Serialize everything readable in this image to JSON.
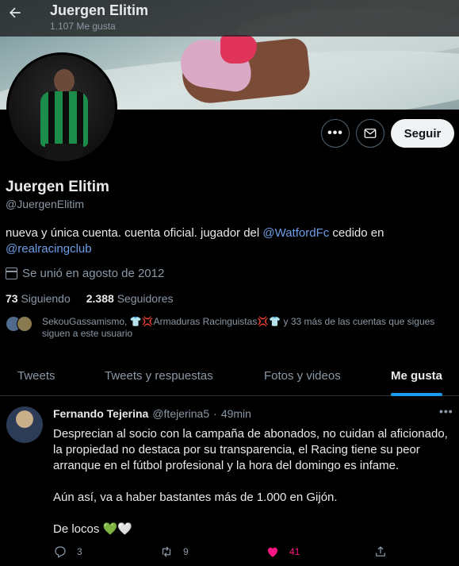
{
  "header": {
    "title": "Juergen Elitim",
    "subtitle": "1.107 Me gusta"
  },
  "profile": {
    "name": "Juergen Elitim",
    "handle": "@JuergenElitim",
    "bio_prefix": "nueva y única cuenta. cuenta oficial. jugador del ",
    "bio_link1": "@WatfordFc",
    "bio_mid": " cedido en ",
    "bio_link2": "@realracingclub",
    "joined": "Se unió en agosto de 2012",
    "following_count": "73",
    "following_label": "Siguiendo",
    "followers_count": "2.388",
    "followers_label": "Seguidores",
    "followed_by": "SekouGassamismo, 👕💢Armaduras Racinguistas💢👕 y 33 más de las cuentas que sigues siguen a este usuario",
    "follow_label": "Seguir",
    "more_label": "•••"
  },
  "tabs": [
    {
      "label": "Tweets"
    },
    {
      "label": "Tweets y respuestas"
    },
    {
      "label": "Fotos y videos"
    },
    {
      "label": "Me gusta"
    }
  ],
  "tweet": {
    "name": "Fernando Tejerina",
    "handle": "@ftejerina5",
    "dot": "·",
    "time": "49min",
    "more": "•••",
    "paragraph1": "Desprecian al socio con la campaña de abonados, no cuidan al aficionado, la propiedad no destaca por su transparencia, el Racing tiene su peor arranque en el fútbol profesional y la hora del domingo es infame.",
    "paragraph2": "Aún así, va a haber bastantes más de 1.000 en Gijón.",
    "paragraph3": "De locos",
    "heart_green": "💚",
    "heart_white": "🤍",
    "replies": "3",
    "retweets": "9",
    "likes": "41"
  },
  "colors": {
    "accent": "#1d9bf0",
    "link": "#6e9ee8",
    "like": "#f91880"
  }
}
